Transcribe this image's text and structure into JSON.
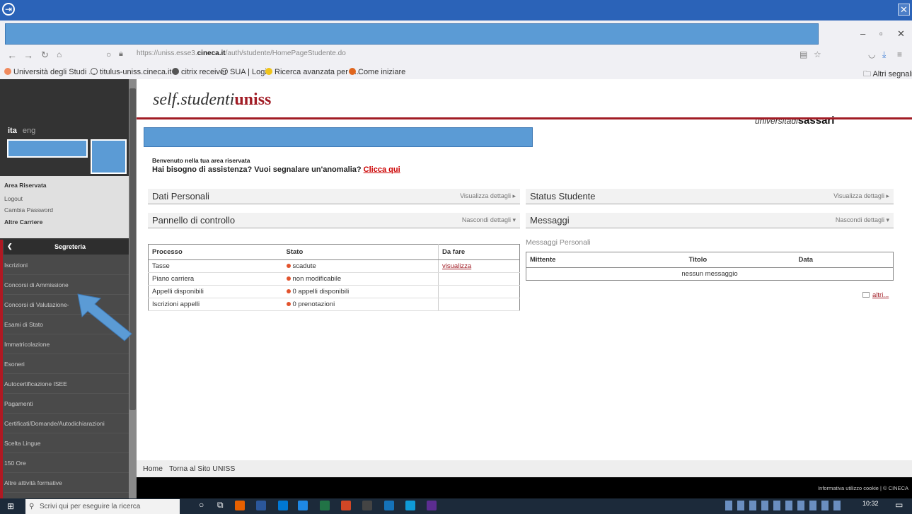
{
  "browser": {
    "url_prefix": "https://uniss.esse3.",
    "url_domain": "cineca.it",
    "url_path": "/auth/studente/HomePageStudente.do",
    "bookmarks": [
      "Università degli Studi ...",
      "titulus-uniss.cineca.it",
      "citrix receiver",
      "SUA | Login",
      "Ricerca avanzata per d...",
      "Come iniziare"
    ],
    "other_bookmarks": "Altri segnalibri"
  },
  "sidebar": {
    "lang_active": "ita",
    "lang_other": "eng",
    "area": "Area Riservata",
    "logout": "Logout",
    "change_password": "Cambia Password",
    "other_careers": "Altre Carriere",
    "section": "Segreteria",
    "items": [
      "Iscrizioni",
      "Concorsi di Ammissione",
      "Concorsi di Valutazione-",
      "Esami di Stato",
      "Immatricolazione",
      "Esoneri",
      "Autocertificazione ISEE",
      "Pagamenti",
      "Certificati/Domande/Autodichiarazioni",
      "Scelta Lingue",
      "150 Ore",
      "Altre attività formative"
    ]
  },
  "header": {
    "brand_a": "self.studenti",
    "brand_b": "uniss",
    "uni_a": "universitàdi",
    "uni_b": "sassari"
  },
  "main": {
    "welcome": "Benvenuto nella tua area riservata",
    "help": "Hai bisogno di assistenza? Vuoi segnalare un'anomalia?",
    "help_link": "Clicca qui",
    "dati_personali": "Dati Personali",
    "status_studente": "Status Studente",
    "pannello": "Pannello di controllo",
    "messaggi": "Messaggi",
    "show_details": "Visualizza dettagli",
    "hide_details": "Nascondi dettagli",
    "table": {
      "headers": [
        "Processo",
        "Stato",
        "Da fare"
      ],
      "rows": [
        {
          "processo": "Tasse",
          "stato": "scadute",
          "da_fare": "visualizza"
        },
        {
          "processo": "Piano carriera",
          "stato": "non modificabile",
          "da_fare": ""
        },
        {
          "processo": "Appelli disponibili",
          "stato": "0 appelli disponibili",
          "da_fare": ""
        },
        {
          "processo": "Iscrizioni appelli",
          "stato": "0 prenotazioni",
          "da_fare": ""
        }
      ]
    },
    "messaggi_personali": "Messaggi Personali",
    "msg_headers": [
      "Mittente",
      "Titolo",
      "Data"
    ],
    "no_message": "nessun messaggio",
    "altri": "altri..."
  },
  "footer": {
    "home": "Home",
    "torna": "Torna al Sito UNISS",
    "cookie": "Informativa utilizzo cookie | © CINECA"
  },
  "taskbar": {
    "search": "Scrivi qui per eseguire la ricerca",
    "time": "10:32"
  },
  "colors": {
    "brand_red": "#a11c25",
    "mask_blue": "#5b9bd5",
    "sidebar_dark": "#4a4a4a"
  }
}
